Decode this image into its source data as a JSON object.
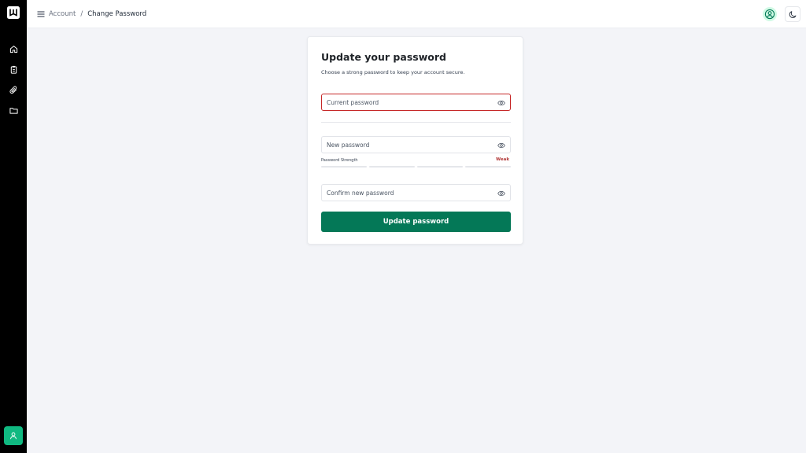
{
  "colors": {
    "sidebar_bg": "#000000",
    "page_bg": "#f3f4f8",
    "accent": "#047857",
    "accent_light": "#10b981",
    "error": "#c62828",
    "strength_weak": "#b23a3a"
  },
  "sidebar": {
    "items": [
      {
        "icon": "home-icon"
      },
      {
        "icon": "clipboard-icon"
      },
      {
        "icon": "paperclip-icon"
      },
      {
        "icon": "folder-icon"
      }
    ],
    "footer_icon": "user-icon"
  },
  "header": {
    "breadcrumb": {
      "parent": "Account",
      "separator": "/",
      "current": "Change Password"
    },
    "profile_icon": "user-circle-icon",
    "theme_icon": "moon-icon"
  },
  "form": {
    "title": "Update your password",
    "subtitle": "Choose a strong password to keep your account secure.",
    "current_password": {
      "value": "",
      "placeholder": "Current password",
      "state": "error"
    },
    "new_password": {
      "value": "",
      "placeholder": "New password"
    },
    "strength": {
      "label": "Password Strength",
      "value": "Weak",
      "segments_filled": 0,
      "segments_total": 4
    },
    "confirm_password": {
      "value": "",
      "placeholder": "Confirm new password"
    },
    "submit_label": "Update password"
  }
}
